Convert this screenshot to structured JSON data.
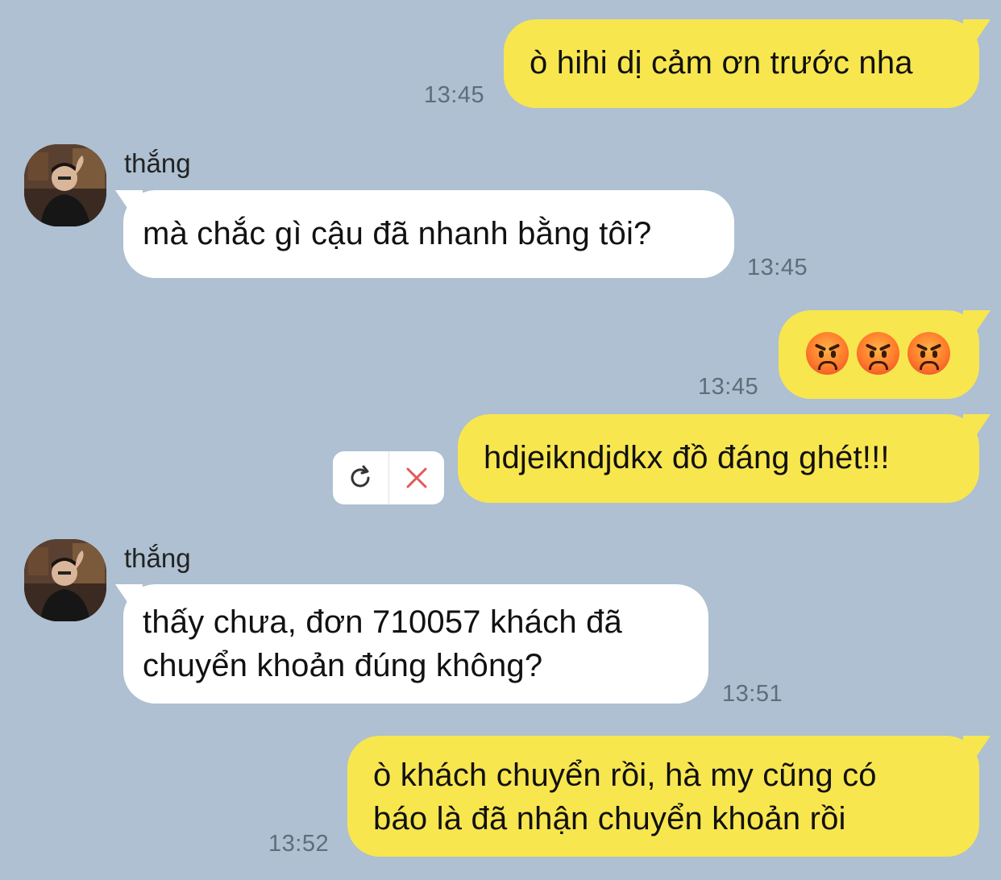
{
  "chat": {
    "contact_name": "thắng",
    "messages": [
      {
        "direction": "out",
        "text": "ò hihi dị cảm ơn trước nha",
        "time": "13:45"
      },
      {
        "direction": "in",
        "sender": "thắng",
        "text": "mà chắc gì cậu đã nhanh bằng tôi?",
        "time": "13:45"
      },
      {
        "direction": "out",
        "emoji": "angry-face x3",
        "time": "13:45"
      },
      {
        "direction": "out",
        "text": "hdjeikndjdkx đồ đáng ghét!!!",
        "status": "failed"
      },
      {
        "direction": "in",
        "sender": "thắng",
        "text_line1": "thấy chưa, đơn 710057 khách đã",
        "text_line2": "chuyển khoản đúng không?",
        "time": "13:51"
      },
      {
        "direction": "out",
        "text_line1": "ò khách chuyển rồi, hà my cũng có",
        "text_line2": "báo là đã nhận chuyển khoản rồi",
        "time": "13:52"
      }
    ]
  },
  "colors": {
    "background": "#aec0d1",
    "outgoing_bubble": "#f8e64f",
    "incoming_bubble": "#ffffff",
    "timestamp": "#5f6d7a",
    "cancel_x": "#e05a5a"
  },
  "icons": {
    "retry": "retry-icon",
    "cancel": "close-icon",
    "emoji": "angry-face-emoji"
  }
}
